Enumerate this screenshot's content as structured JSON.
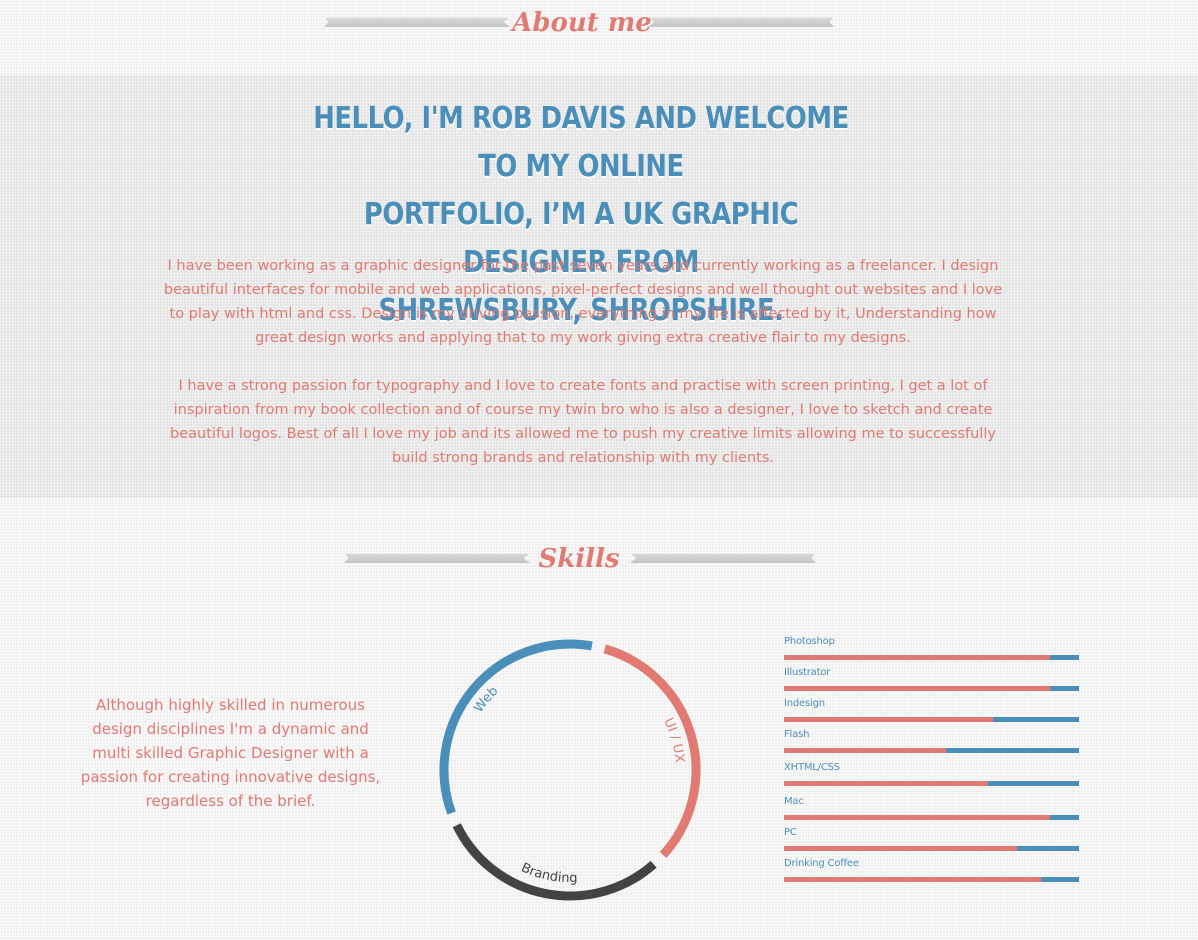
{
  "about": {
    "heading": "About me",
    "title_lines": [
      "Hello, I'm Rob Davis and welcome to my online",
      "portfolio, I’m a UK graphic designer from",
      "Shrewsbury, Shropshire."
    ],
    "paragraphs": [
      "I have been working as a graphic designer for the past seven years and currently working as a freelancer. I design beautiful interfaces for mobile and web applications, pixel-perfect designs and well thought out websites and I love to play with html and css. Design is my driving passion, everything in my life is affected by it, Understanding how great design works and applying that to my work giving extra creative flair to my designs.",
      "I have a strong passion for typography and I love to create fonts and practise with screen printing, I get a lot of inspiration from my book collection and of course my twin bro who is also a designer, I love to sketch and create beautiful logos. Best of all I love my job and its allowed me to push my creative limits allowing me to successfully build strong brands and relationship with my clients."
    ]
  },
  "skills": {
    "heading": "Skills",
    "intro": "Although highly skilled in numerous design disciplines I'm a dynamic and multi skilled Graphic Designer with a passion for creating innovative designs, regardless of the brief.",
    "chart_data": {
      "type": "pie",
      "categories": [
        "UI / UX",
        "Branding",
        "Web"
      ],
      "values": [
        34,
        31,
        35
      ],
      "colors": [
        "#e07a72",
        "#434343",
        "#4a8fba"
      ]
    },
    "bars": [
      {
        "label": "Photoshop",
        "level": 0.9
      },
      {
        "label": "Illustrator",
        "level": 0.9
      },
      {
        "label": "Indesign",
        "level": 0.71
      },
      {
        "label": "Flash",
        "level": 0.55
      },
      {
        "label": "XHTML/CSS",
        "level": 0.69
      },
      {
        "label": "Mac",
        "level": 0.9
      },
      {
        "label": "PC",
        "level": 0.79
      },
      {
        "label": "Drinking Coffee",
        "level": 0.87
      }
    ]
  },
  "colors": {
    "accent_red": "#e07a72",
    "accent_blue": "#4a8fba",
    "dark": "#434343"
  }
}
